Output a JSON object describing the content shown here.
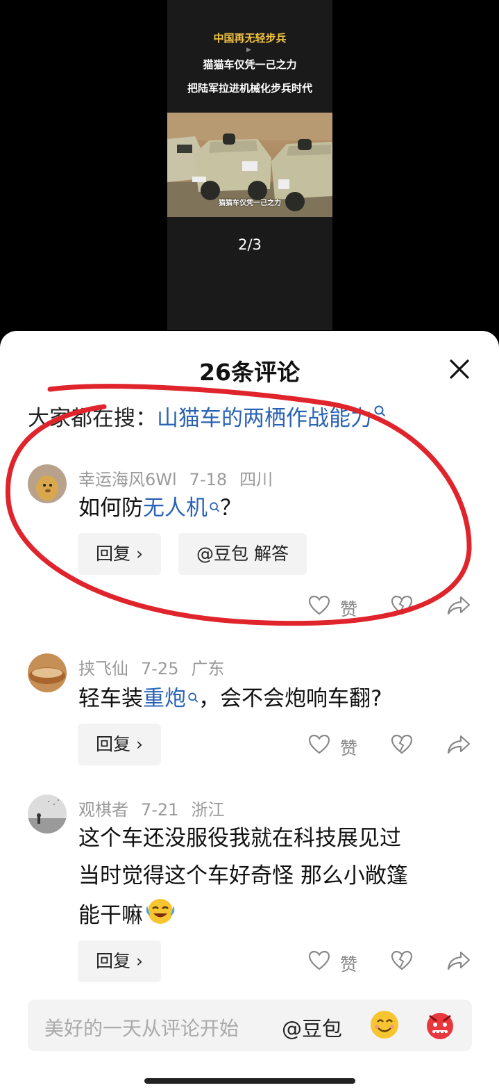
{
  "video": {
    "title_line1": "中国再无轻步兵",
    "title_line2": "猫猫车仅凭一己之力",
    "title_line3": "把陆军拉进机械化步兵时代",
    "caption": "猫猫车仅凭一己之力",
    "page_indicator": "2/3"
  },
  "sheet": {
    "title": "26条评论",
    "search_prefix": "大家都在搜：",
    "search_link": "山猫车的两栖作战能力"
  },
  "comments": [
    {
      "user": "幸运海风6Wl",
      "date": "7-18",
      "location": "四川",
      "text_pre": "如何防",
      "text_link": "无人机",
      "text_post": "？",
      "reply_label": "回复 ›",
      "ai_label": "@豆包 解答",
      "like_label": "赞"
    },
    {
      "user": "挟飞仙",
      "date": "7-25",
      "location": "广东",
      "text_pre": "轻车装",
      "text_link": "重炮",
      "text_post": "，会不会炮响车翻?",
      "reply_label": "回复 ›",
      "like_label": "赞"
    },
    {
      "user": "观棋者",
      "date": "7-21",
      "location": "浙江",
      "lines": [
        "这个车还没服役我就在科技展见过",
        "当时觉得这个车好奇怪 那么小敞篷",
        "能干嘛"
      ],
      "emoji": "crying-laughing-emoji",
      "reply_label": "回复 ›",
      "like_label": "赞"
    }
  ],
  "input": {
    "placeholder": "美好的一天从评论开始",
    "at_label": "@豆包"
  },
  "colors": {
    "link": "#2a63b5",
    "annotation": "#e0242b",
    "accent_title": "#f4c542"
  }
}
